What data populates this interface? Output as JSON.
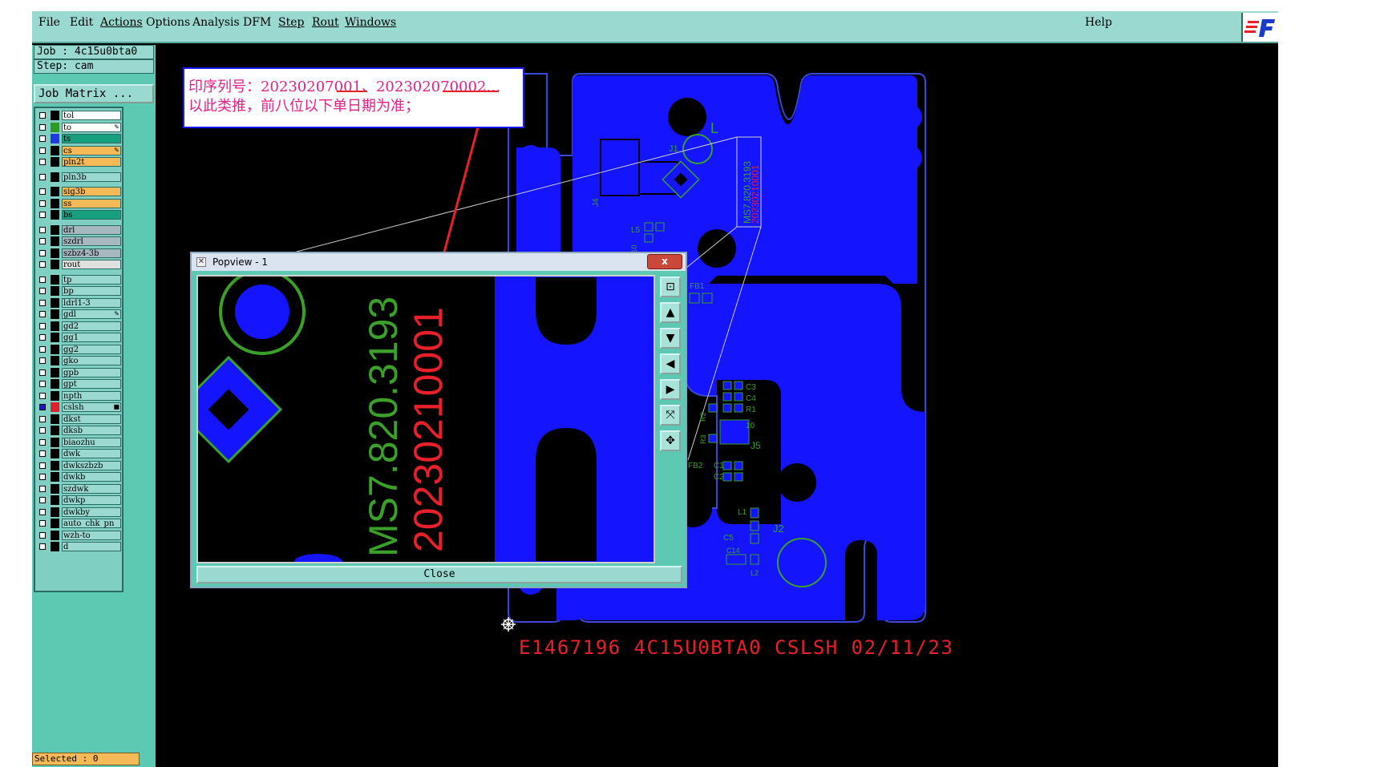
{
  "menu": {
    "items": [
      "File",
      "Edit",
      "Actions",
      "Options",
      "Analysis",
      "DFM",
      "Step",
      "Rout",
      "Windows"
    ],
    "help": "Help"
  },
  "left_panel": {
    "job": "Job : 4c15u0bta0",
    "step": "Step: cam",
    "job_matrix_button": "Job Matrix ...",
    "selected": "Selected : 0"
  },
  "layers": [
    {
      "name": "tol",
      "color": "#ffffff",
      "swatch": "#000000",
      "mark": ""
    },
    {
      "name": "to",
      "color": "#ffffff",
      "swatch": "#2e9a1e",
      "mark": "✎"
    },
    {
      "name": "ts",
      "color": "#16a07e",
      "swatch": "#1e3ae0",
      "mark": ""
    },
    {
      "name": "cs",
      "color": "#f6b958",
      "swatch": "#000000",
      "mark": "✎"
    },
    {
      "name": "pln2t",
      "color": "#f6b958",
      "swatch": "#000000",
      "mark": ""
    },
    {
      "name": "pln3b",
      "color": "#9ad9d0",
      "swatch": "#000000",
      "mark": ""
    },
    {
      "name": "sig3b",
      "color": "#f6b958",
      "swatch": "#000000",
      "mark": ""
    },
    {
      "name": "ss",
      "color": "#f6b958",
      "swatch": "#000000",
      "mark": ""
    },
    {
      "name": "bs",
      "color": "#16a07e",
      "swatch": "#000000",
      "mark": ""
    },
    {
      "name": "drl",
      "color": "#a8b8c0",
      "swatch": "#000000",
      "mark": ""
    },
    {
      "name": "szdrl",
      "color": "#a8b8c0",
      "swatch": "#000000",
      "mark": ""
    },
    {
      "name": "szbz4-3b",
      "color": "#a8b8c0",
      "swatch": "#000000",
      "mark": ""
    },
    {
      "name": "rout",
      "color": "#e0e0e0",
      "swatch": "#000000",
      "mark": ""
    },
    {
      "name": "tp",
      "color": "#9ad9d0",
      "swatch": "#000000",
      "mark": ""
    },
    {
      "name": "bp",
      "color": "#9ad9d0",
      "swatch": "#000000",
      "mark": ""
    },
    {
      "name": "ldrl1-3",
      "color": "#9ad9d0",
      "swatch": "#000000",
      "mark": ""
    },
    {
      "name": "gdl",
      "color": "#9ad9d0",
      "swatch": "#000000",
      "mark": "✎"
    },
    {
      "name": "gd2",
      "color": "#9ad9d0",
      "swatch": "#000000",
      "mark": ""
    },
    {
      "name": "gg1",
      "color": "#9ad9d0",
      "swatch": "#000000",
      "mark": ""
    },
    {
      "name": "gg2",
      "color": "#9ad9d0",
      "swatch": "#000000",
      "mark": ""
    },
    {
      "name": "gko",
      "color": "#9ad9d0",
      "swatch": "#000000",
      "mark": ""
    },
    {
      "name": "gpb",
      "color": "#9ad9d0",
      "swatch": "#000000",
      "mark": ""
    },
    {
      "name": "gpt",
      "color": "#9ad9d0",
      "swatch": "#000000",
      "mark": ""
    },
    {
      "name": "npth",
      "color": "#9ad9d0",
      "swatch": "#000000",
      "mark": ""
    },
    {
      "name": "cslsh",
      "color": "#9ad9d0",
      "swatch": "#e0202a",
      "mark": "■"
    },
    {
      "name": "dkst",
      "color": "#9ad9d0",
      "swatch": "#000000",
      "mark": ""
    },
    {
      "name": "dksb",
      "color": "#9ad9d0",
      "swatch": "#000000",
      "mark": ""
    },
    {
      "name": "biaozhu",
      "color": "#9ad9d0",
      "swatch": "#000000",
      "mark": ""
    },
    {
      "name": "dwk",
      "color": "#9ad9d0",
      "swatch": "#000000",
      "mark": ""
    },
    {
      "name": "dwkszbzb",
      "color": "#9ad9d0",
      "swatch": "#000000",
      "mark": ""
    },
    {
      "name": "dwkb",
      "color": "#9ad9d0",
      "swatch": "#000000",
      "mark": ""
    },
    {
      "name": "szdwk",
      "color": "#9ad9d0",
      "swatch": "#000000",
      "mark": ""
    },
    {
      "name": "dwkp",
      "color": "#9ad9d0",
      "swatch": "#000000",
      "mark": ""
    },
    {
      "name": "dwkby",
      "color": "#9ad9d0",
      "swatch": "#000000",
      "mark": ""
    },
    {
      "name": "auto_chk_pn",
      "color": "#9ad9d0",
      "swatch": "#000000",
      "mark": ""
    },
    {
      "name": "wzh-to",
      "color": "#9ad9d0",
      "swatch": "#000000",
      "mark": ""
    },
    {
      "name": "d",
      "color": "#9ad9d0",
      "swatch": "#000000",
      "mark": ""
    }
  ],
  "annotation": {
    "line1": "印序列号：20230207001、202302070002…",
    "line2": "以此类推，前八位以下单日期为准；"
  },
  "popview": {
    "title": "Popview - 1",
    "close_x": "x",
    "close_button": "Close",
    "text_green": "MS7.820.3193",
    "text_red": "20230210001"
  },
  "board": {
    "labels": {
      "j1": "J1",
      "j2": "J2",
      "j4": "J4",
      "l5": "L5",
      "fb1": "FB1",
      "fb2": "FB2",
      "c3": "C3",
      "c4": "C4",
      "r1": "R1",
      "r2": "R2",
      "r3": "R3",
      "j5": "J5",
      "c1": "C1",
      "c2": "C2",
      "l1": "L1",
      "c5": "C5",
      "c14": "C14",
      "l2": "L2",
      "l": "L",
      "c10": "C10",
      "ten": "10"
    },
    "silk_green": "MS7.820.3193",
    "silk_red": "20230210001",
    "bottom_text": "E1467196 4C15U0BTA0 CSLSH 02/11/23"
  },
  "colors": {
    "copper": "#1414ff",
    "silk": "#3aa02a",
    "mark": "#e8202a",
    "panel": "#5ec9b3"
  }
}
